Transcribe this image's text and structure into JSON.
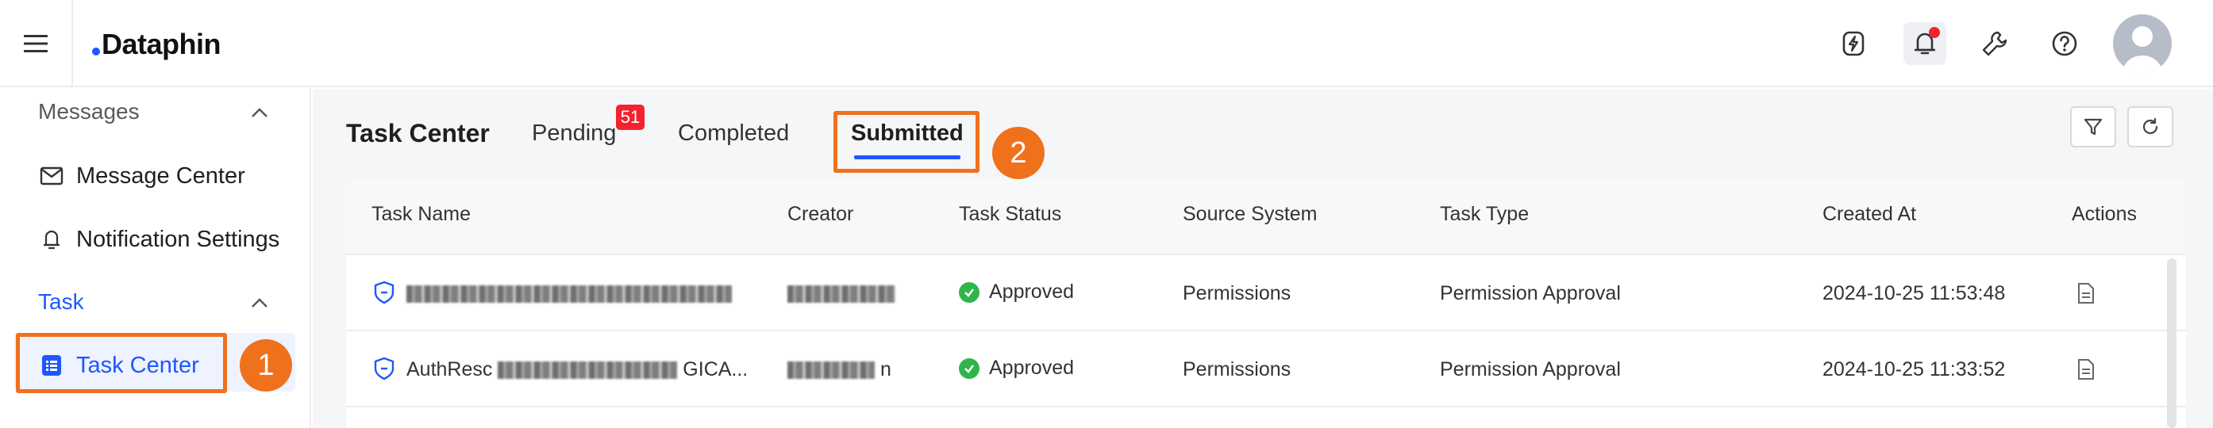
{
  "app": {
    "logo_text": "Dataphin"
  },
  "topbar": {
    "icons": [
      "menu-icon",
      "lightning-icon",
      "bell-icon",
      "tools-icon",
      "help-icon",
      "avatar"
    ],
    "colors": {
      "accent": "#1d57ff",
      "notification": "#f5222d"
    }
  },
  "sidebar": {
    "group_messages": "Messages",
    "message_center": "Message Center",
    "notification_settings": "Notification Settings",
    "group_task": "Task",
    "task_center": "Task Center"
  },
  "main": {
    "title": "Task Center",
    "tabs": {
      "pending": "Pending",
      "pending_count": "51",
      "completed": "Completed",
      "submitted": "Submitted"
    },
    "table": {
      "headers": {
        "task_name": "Task Name",
        "creator": "Creator",
        "task_status": "Task Status",
        "source_system": "Source System",
        "task_type": "Task Type",
        "created_at": "Created At",
        "actions": "Actions"
      },
      "rows": [
        {
          "task_name": "",
          "status": "Approved",
          "source_system": "Permissions",
          "task_type": "Permission Approval",
          "created_at": "2024-10-25 11:53:48"
        },
        {
          "task_name_prefix": "AuthResc",
          "task_name_suffix": "GICA...",
          "creator_suffix": "n",
          "status": "Approved",
          "source_system": "Permissions",
          "task_type": "Permission Approval",
          "created_at": "2024-10-25 11:33:52"
        }
      ]
    }
  },
  "annotations": {
    "step1": "1",
    "step2": "2",
    "color": "#f0711c"
  }
}
